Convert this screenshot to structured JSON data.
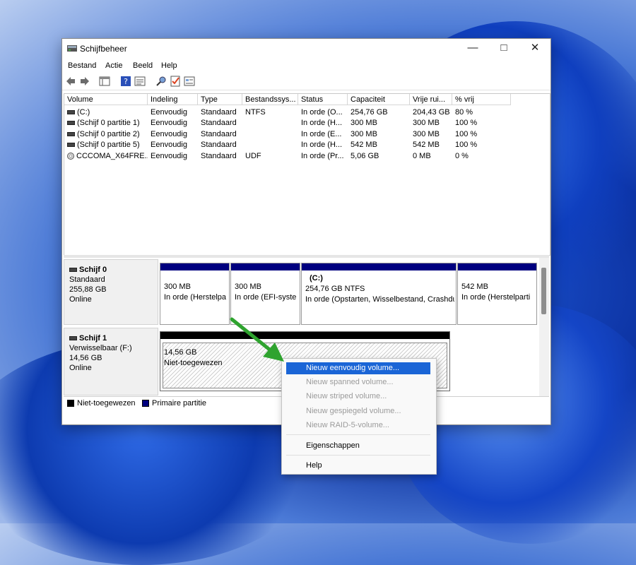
{
  "window": {
    "title": "Schijfbeheer"
  },
  "menu": [
    "Bestand",
    "Actie",
    "Beeld",
    "Help"
  ],
  "volume_list": {
    "columns": [
      "Volume",
      "Indeling",
      "Type",
      "Bestandssys...",
      "Status",
      "Capaciteit",
      "Vrije rui...",
      "% vrij"
    ],
    "rows": [
      {
        "volume": "(C:)",
        "layout": "Eenvoudig",
        "type": "Standaard",
        "fs": "NTFS",
        "status": "In orde (O...",
        "capacity": "254,76 GB",
        "free": "204,43 GB",
        "pct": "80 %",
        "icon": "drive-icon"
      },
      {
        "volume": "(Schijf 0 partitie 1)",
        "layout": "Eenvoudig",
        "type": "Standaard",
        "fs": "",
        "status": "In orde (H...",
        "capacity": "300 MB",
        "free": "300 MB",
        "pct": "100 %",
        "icon": "drive-icon"
      },
      {
        "volume": "(Schijf 0 partitie 2)",
        "layout": "Eenvoudig",
        "type": "Standaard",
        "fs": "",
        "status": "In orde (E...",
        "capacity": "300 MB",
        "free": "300 MB",
        "pct": "100 %",
        "icon": "drive-icon"
      },
      {
        "volume": "(Schijf 0 partitie 5)",
        "layout": "Eenvoudig",
        "type": "Standaard",
        "fs": "",
        "status": "In orde (H...",
        "capacity": "542 MB",
        "free": "542 MB",
        "pct": "100 %",
        "icon": "drive-icon"
      },
      {
        "volume": "CCCOMA_X64FRE...",
        "layout": "Eenvoudig",
        "type": "Standaard",
        "fs": "UDF",
        "status": "In orde (Pr...",
        "capacity": "5,06 GB",
        "free": "0 MB",
        "pct": "0 %",
        "icon": "cd-icon"
      }
    ]
  },
  "disks": [
    {
      "name": "Schijf 0",
      "lines": [
        "Standaard",
        "255,88 GB",
        "Online"
      ],
      "partitions": [
        {
          "title": "",
          "line1": "300 MB",
          "line2": "In orde (Herstelpa"
        },
        {
          "title": "",
          "line1": "300 MB",
          "line2": "In orde (EFI-syste"
        },
        {
          "title": "(C:)",
          "line1": "254,76 GB NTFS",
          "line2": "In orde (Opstarten, Wisselbestand, Crashdu"
        },
        {
          "title": "",
          "line1": "542 MB",
          "line2": "In orde (Herstelparti"
        }
      ]
    },
    {
      "name": "Schijf 1",
      "lines": [
        "Verwisselbaar (F:)",
        "14,56 GB",
        "Online"
      ],
      "partitions": [
        {
          "title": "",
          "line1": "14,56 GB",
          "line2": "Niet-toegewezen"
        }
      ]
    }
  ],
  "legend": [
    {
      "label": "Niet-toegewezen",
      "color": "#000000"
    },
    {
      "label": "Primaire partitie",
      "color": "#00007f"
    }
  ],
  "context_menu": {
    "items": [
      {
        "label": "Nieuw eenvoudig volume...",
        "state": "highlighted"
      },
      {
        "label": "Nieuw spanned volume...",
        "state": "disabled"
      },
      {
        "label": "Nieuw striped volume...",
        "state": "disabled"
      },
      {
        "label": "Nieuw gespiegeld volume...",
        "state": "disabled"
      },
      {
        "label": "Nieuw RAID-5-volume...",
        "state": "disabled"
      },
      {
        "label": "Eigenschappen",
        "state": "enabled"
      },
      {
        "label": "Help",
        "state": "enabled"
      }
    ]
  },
  "colors": {
    "primary_partition": "#00007f",
    "unallocated": "#000000",
    "menu_highlight": "#1a65d6",
    "annotation_arrow": "#2fa32f"
  }
}
